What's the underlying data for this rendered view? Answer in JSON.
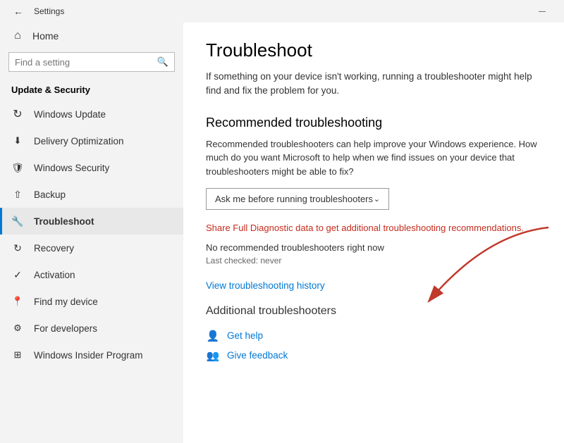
{
  "titlebar": {
    "title": "Settings",
    "minimize_label": "—"
  },
  "sidebar": {
    "home_label": "Home",
    "search_placeholder": "Find a setting",
    "section_title": "Update & Security",
    "items": [
      {
        "id": "windows-update",
        "label": "Windows Update",
        "icon": "↻"
      },
      {
        "id": "delivery-optimization",
        "label": "Delivery Optimization",
        "icon": "⬇"
      },
      {
        "id": "windows-security",
        "label": "Windows Security",
        "icon": "🛡"
      },
      {
        "id": "backup",
        "label": "Backup",
        "icon": "↑"
      },
      {
        "id": "troubleshoot",
        "label": "Troubleshoot",
        "icon": "🔧",
        "active": true
      },
      {
        "id": "recovery",
        "label": "Recovery",
        "icon": "↺"
      },
      {
        "id": "activation",
        "label": "Activation",
        "icon": "✓"
      },
      {
        "id": "find-my-device",
        "label": "Find my device",
        "icon": "📍"
      },
      {
        "id": "for-developers",
        "label": "For developers",
        "icon": "⚙"
      },
      {
        "id": "windows-insider",
        "label": "Windows Insider Program",
        "icon": "⊞"
      }
    ]
  },
  "content": {
    "page_title": "Troubleshoot",
    "page_subtitle": "If something on your device isn't working, running a troubleshooter might help find and fix the problem for you.",
    "recommended_heading": "Recommended troubleshooting",
    "recommended_description": "Recommended troubleshooters can help improve your Windows experience. How much do you want Microsoft to help when we find issues on your device that troubleshooters might be able to fix?",
    "dropdown_label": "Ask me before running troubleshooters",
    "share_link_text": "Share Full Diagnostic data to get additional troubleshooting recommendations.",
    "no_troubleshooters": "No recommended troubleshooters right now",
    "last_checked": "Last checked: never",
    "view_history": "View troubleshooting history",
    "additional_section": "Additional troubleshooters",
    "get_help": "Get help",
    "give_feedback": "Give feedback"
  }
}
